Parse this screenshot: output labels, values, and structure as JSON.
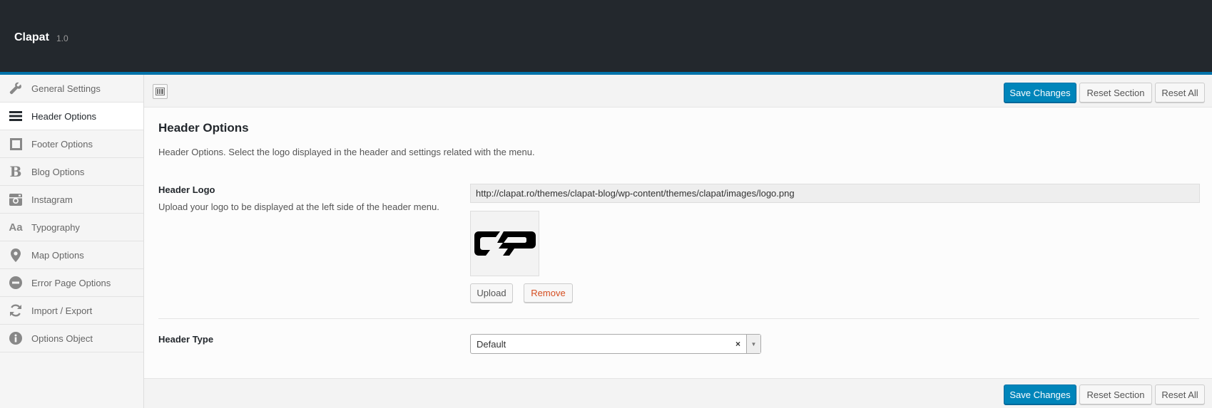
{
  "app": {
    "title": "Clapat",
    "version": "1.0"
  },
  "sidebar": {
    "items": [
      {
        "label": "General Settings",
        "icon": "wrench-icon"
      },
      {
        "label": "Header Options",
        "icon": "menu-bars-icon",
        "active": true
      },
      {
        "label": "Footer Options",
        "icon": "square-icon"
      },
      {
        "label": "Blog Options",
        "icon": "bold-b-icon"
      },
      {
        "label": "Instagram",
        "icon": "instagram-icon"
      },
      {
        "label": "Typography",
        "icon": "typography-aa-icon"
      },
      {
        "label": "Map Options",
        "icon": "map-pin-icon"
      },
      {
        "label": "Error Page Options",
        "icon": "minus-circle-icon"
      },
      {
        "label": "Import / Export",
        "icon": "refresh-icon"
      },
      {
        "label": "Options Object",
        "icon": "info-icon"
      }
    ]
  },
  "toolbar": {
    "save_label": "Save Changes",
    "reset_section_label": "Reset Section",
    "reset_all_label": "Reset All"
  },
  "section": {
    "title": "Header Options",
    "description": "Header Options. Select the logo displayed in the header and settings related with the menu."
  },
  "header_logo": {
    "label": "Header Logo",
    "description": "Upload your logo to be displayed at the left side of the header menu.",
    "url": "http://clapat.ro/themes/clapat-blog/wp-content/themes/clapat/images/logo.png",
    "upload_label": "Upload",
    "remove_label": "Remove"
  },
  "header_type": {
    "label": "Header Type",
    "value": "Default",
    "clear_glyph": "×",
    "arrow_glyph": "▼"
  },
  "colors": {
    "accent": "#0073aa",
    "primary_button": "#0085ba",
    "header_bg": "#23282d",
    "remove": "#d54e21"
  }
}
